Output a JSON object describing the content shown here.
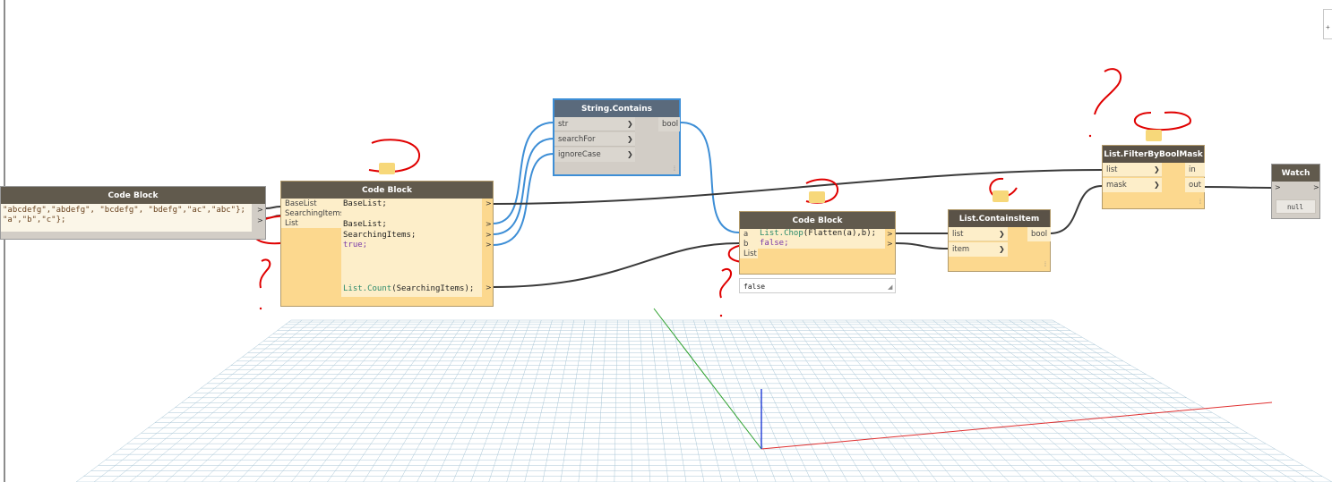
{
  "nodes": {
    "code_block_left": {
      "title": "Code Block",
      "line1": "\"abcdefg\",\"abdefg\", \"bcdefg\", \"bdefg\",\"ac\",\"abc\"};",
      "line2": "\"a\",\"b\",\"c\"};",
      "out1": ">",
      "out2": ">"
    },
    "code_block_main": {
      "title": "Code Block",
      "inputs": [
        "BaseList",
        "SearchingItems",
        "List"
      ],
      "code_line1": "BaseList;",
      "code_line2": "BaseList;",
      "code_line3": "SearchingItems;",
      "code_line4": "true;",
      "code_call": "List.Count",
      "code_call_args": "(SearchingItems);",
      "out": ">"
    },
    "string_contains": {
      "title": "String.Contains",
      "inputs": [
        "str",
        "searchFor",
        "ignoreCase"
      ],
      "output": "bool"
    },
    "code_block_chop": {
      "title": "Code Block",
      "inputs": [
        "a",
        "b",
        "List"
      ],
      "code_call": "List.Chop",
      "code_args": "(Flatten(a),b);",
      "code_line2": "false;",
      "preview": "false"
    },
    "list_contains_item": {
      "title": "List.ContainsItem",
      "inputs": [
        "list",
        "item"
      ],
      "output": "bool"
    },
    "list_filter": {
      "title": "List.FilterByBoolMask",
      "inputs": [
        "list",
        "mask"
      ],
      "outputs": [
        "in",
        "out"
      ]
    },
    "watch": {
      "title": "Watch",
      "in_port": ">",
      "out_port": ">",
      "value": "null"
    }
  },
  "colors": {
    "node_body": "#fdeec9",
    "node_input_bg": "#fcd88e",
    "wire_blue": "#3d8ed6",
    "wire_dark": "#3a3a3a",
    "annotation_red": "#e00000",
    "grid_line": "#a9c6d6"
  }
}
